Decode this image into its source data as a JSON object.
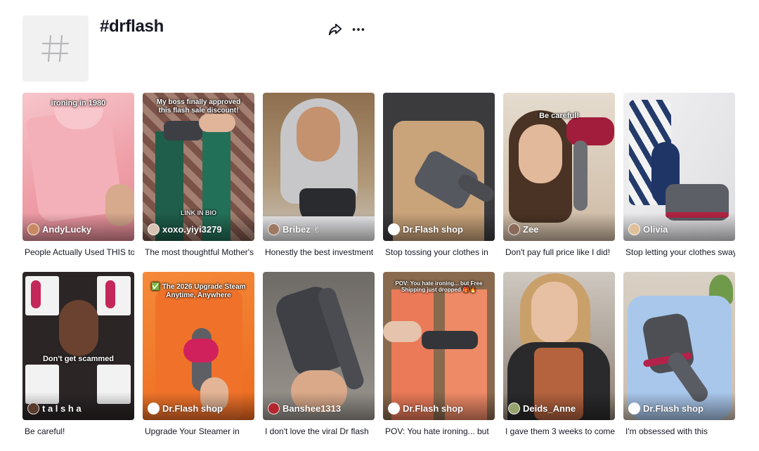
{
  "header": {
    "title": "#drflash",
    "avatar_icon": "hashtag-icon",
    "share_icon": "share-icon",
    "more_icon": "more-dots-icon"
  },
  "videos": [
    {
      "author": "AndyLucky",
      "caption": "People Actually Used THIS to",
      "overlay": "ironing in 1980",
      "bg": "#f1b3b8"
    },
    {
      "author": "xoxo.yiyi3279",
      "caption": "The most thoughtful Mother's",
      "overlay": "My boss finally approved this flash sale discount!",
      "overlay2": "LINK IN BIO",
      "bg": "#6b4b3e"
    },
    {
      "author": "Bribez ✌",
      "caption": "Honestly the best investment",
      "overlay": "",
      "bg": "#9d8a6e"
    },
    {
      "author": "Dr.Flash shop",
      "caption": "Stop tossing your clothes in",
      "overlay": "",
      "bg": "#c9a780"
    },
    {
      "author": "Zee",
      "caption": "Don't pay full price like I did!",
      "overlay": "Be careful!",
      "bg": "#d6c5b2"
    },
    {
      "author": "Olivia",
      "caption": "Stop letting your clothes sway",
      "overlay": "",
      "bg": "#e8e8ea"
    },
    {
      "author": "t a l s h a",
      "caption": "Be careful!",
      "overlay": "Don't get scammed",
      "bg": "#3b2f2c"
    },
    {
      "author": "Dr.Flash shop",
      "caption": "Upgrade Your Steamer in",
      "overlay": "✅ The 2026 Upgrade Steam Anytime, Anywhere",
      "bg": "#f0772a"
    },
    {
      "author": "Banshee1313",
      "caption": "I don't love the viral Dr flash",
      "overlay": "",
      "bg": "#8a8686"
    },
    {
      "author": "Dr.Flash shop",
      "caption": "POV: You hate ironing... but",
      "overlay": "POV: You hate ironing... but Free Shipping just dropped 🎁🔥",
      "bg": "#e07a52"
    },
    {
      "author": "Deids_Anne",
      "caption": "I gave them 3 weeks to come",
      "overlay": "",
      "bg": "#5f4a3e"
    },
    {
      "author": "Dr.Flash shop",
      "caption": "I'm obsessed with this",
      "overlay": "",
      "bg": "#a7c6e8"
    }
  ]
}
